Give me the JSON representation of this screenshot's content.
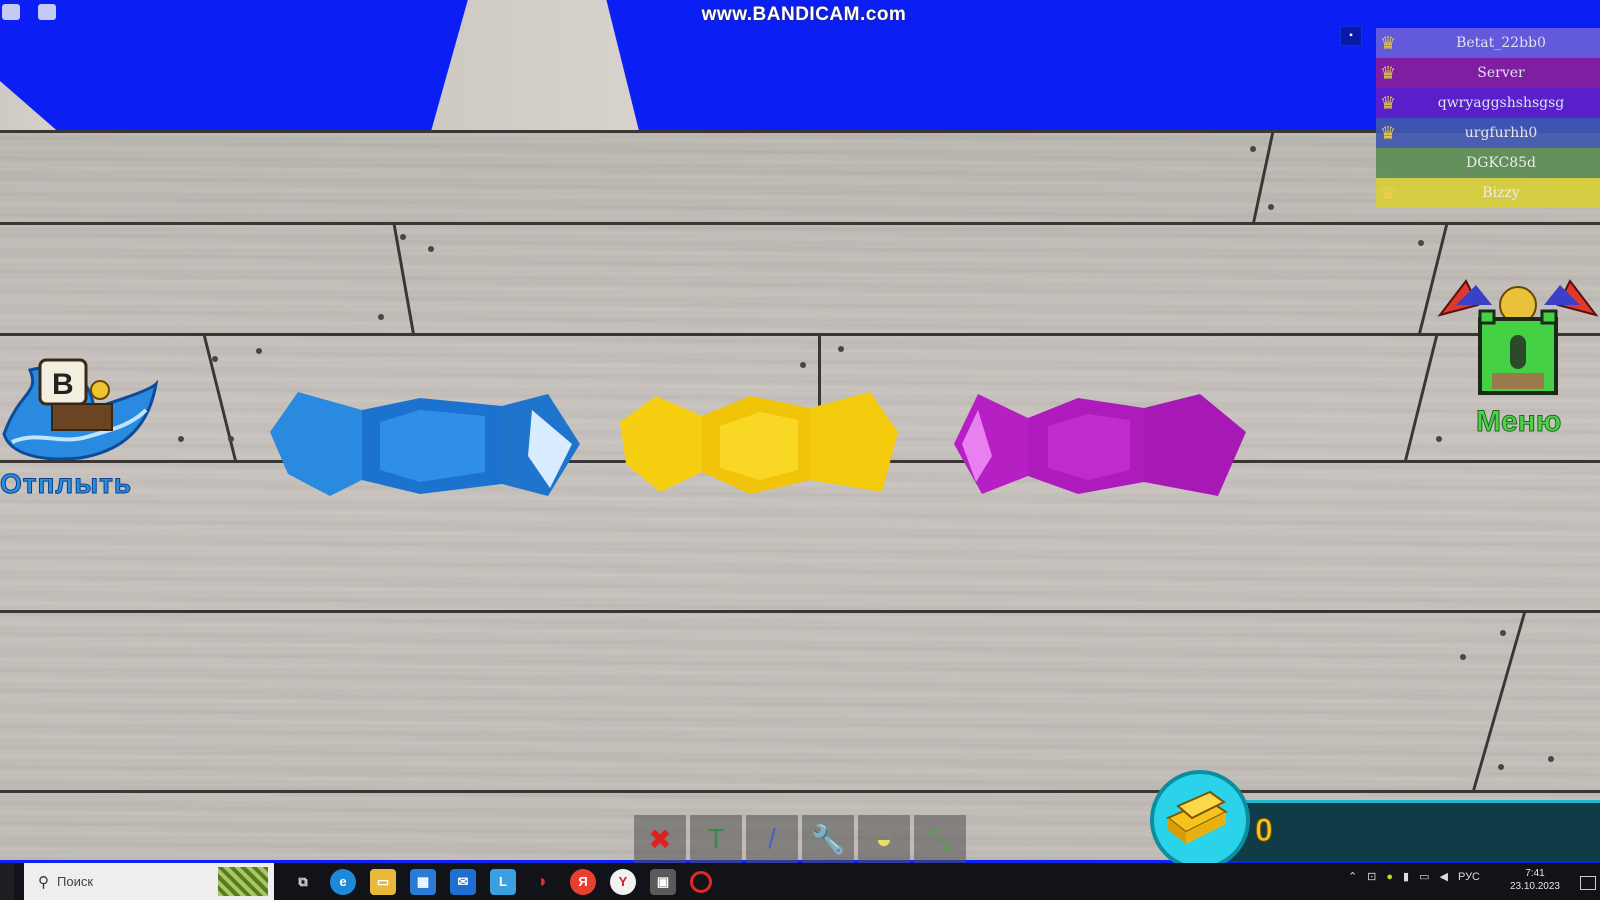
{
  "watermark": "www.BANDICAM.com",
  "player_list": [
    {
      "name": "Betat_22bb0",
      "color": "#6a5fd8"
    },
    {
      "name": "Server",
      "color": "#8a1e9a"
    },
    {
      "name": "qwryaggshshsgsg",
      "color": "#6020c8"
    },
    {
      "name": "urgfurhh0",
      "color": "#4258b0"
    },
    {
      "name": "DGKC85d",
      "color": "#5c8c54"
    },
    {
      "name": "Bizzy",
      "color": "#d7cf3a"
    }
  ],
  "left_button": {
    "label": "Отплыть",
    "icon": "pirate-ship-icon"
  },
  "right_button": {
    "label": "Меню",
    "icon": "castle-menu-icon"
  },
  "candies": [
    {
      "color": "#1e7fd6",
      "name": "blue"
    },
    {
      "color": "#f3cc0e",
      "name": "yellow"
    },
    {
      "color": "#b21cc0",
      "name": "purple"
    }
  ],
  "toolbar": [
    {
      "icon": "delete-icon",
      "glyph": "✖",
      "color": "#e02020"
    },
    {
      "icon": "hammer-icon",
      "glyph": "T",
      "color": "#3c8a4a"
    },
    {
      "icon": "paint-brush-icon",
      "glyph": "/",
      "color": "#3f63c8"
    },
    {
      "icon": "wrench-icon",
      "glyph": "🔧",
      "color": "#9bb4d6"
    },
    {
      "icon": "helmet-icon",
      "glyph": "◒",
      "color": "#e8df5c"
    },
    {
      "icon": "trowel-icon",
      "glyph": "⤡",
      "color": "#4ea24e"
    }
  ],
  "gold": {
    "count": "0",
    "icon": "gold-bars-icon"
  },
  "taskbar": {
    "search_placeholder": "Поиск",
    "apps": [
      "task-view",
      "edge",
      "explorer",
      "store",
      "mail",
      "l-app",
      "antivirus",
      "yandex-browser",
      "yandex",
      "roblox",
      "bandicam"
    ],
    "lang": "РУС",
    "time": "7:41",
    "date": "23.10.2023"
  }
}
